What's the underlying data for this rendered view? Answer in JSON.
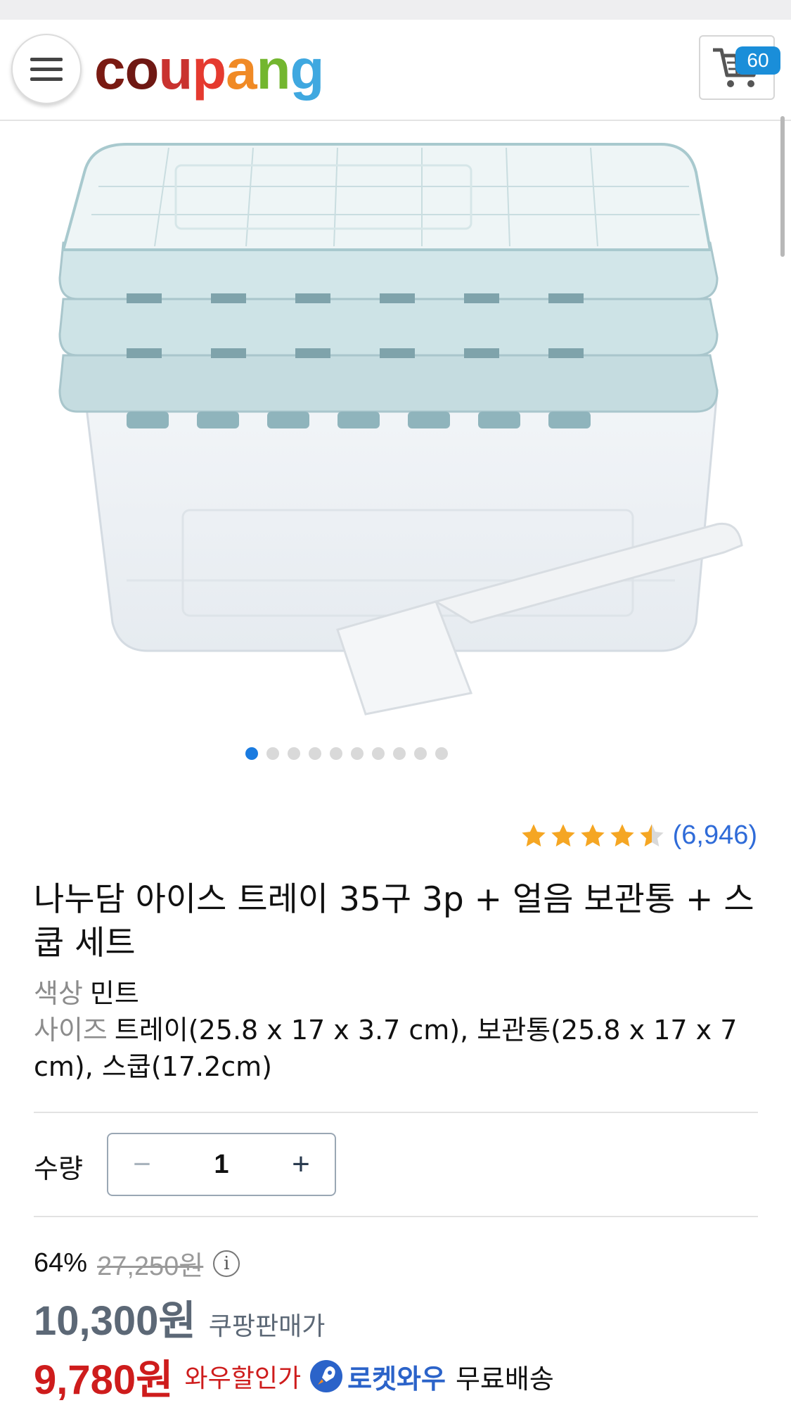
{
  "header": {
    "logo_letters": [
      "c",
      "o",
      "u",
      "p",
      "a",
      "n",
      "g"
    ],
    "cart_count": "60"
  },
  "gallery": {
    "total_images": 10,
    "active_index": 0
  },
  "rating": {
    "stars": 4.5,
    "review_count": "(6,946)"
  },
  "product": {
    "title": "나누담 아이스 트레이 35구 3p + 얼음 보관통 + 스쿱 세트",
    "color_label": "색상",
    "color_value": "민트",
    "size_label": "사이즈",
    "size_value": "트레이(25.8 x 17 x 3.7 cm), 보관통(25.8 x 17 x 7 cm), 스쿱(17.2cm)"
  },
  "quantity": {
    "label": "수량",
    "value": "1",
    "minus": "−",
    "plus": "+"
  },
  "price": {
    "discount_rate": "64%",
    "original_price": "27,250원",
    "info_symbol": "i",
    "sale_price": "10,300원",
    "sale_label": "쿠팡판매가",
    "wow_price": "9,780원",
    "wow_label": "와우할인가",
    "rocket_label": "로켓와우",
    "shipping": "무료배송"
  },
  "colors": {
    "accent_blue": "#1a8ed9",
    "price_red": "#ce1c1c",
    "rocket_blue": "#2b63c9",
    "star_orange": "#f5a623"
  }
}
